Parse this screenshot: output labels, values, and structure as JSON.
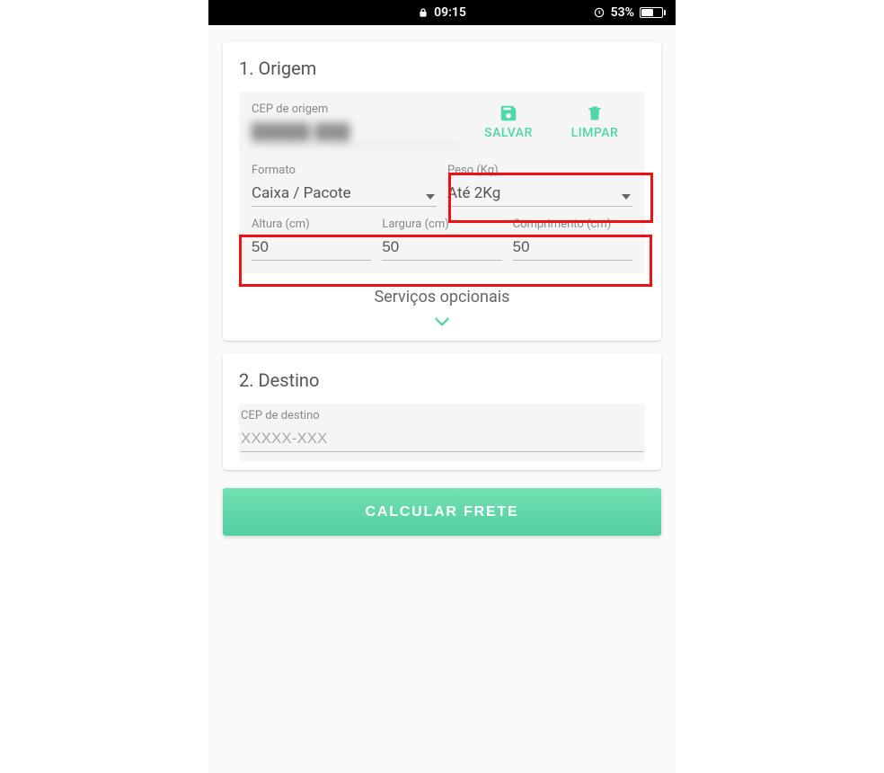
{
  "status": {
    "time": "09:15",
    "battery_pct": "53%",
    "battery_fill_pct": 53
  },
  "origem": {
    "title": "1. Origem",
    "cep_label": "CEP de origem",
    "cep_masked": "█████-███",
    "salvar_label": "SALVAR",
    "limpar_label": "LIMPAR",
    "formato_label": "Formato",
    "formato_value": "Caixa / Pacote",
    "peso_label": "Peso (Kg)",
    "peso_value": "Até 2Kg",
    "altura_label": "Altura (cm)",
    "altura_value": "50",
    "largura_label": "Largura (cm)",
    "largura_value": "50",
    "comprimento_label": "Comprimento (cm)",
    "comprimento_value": "50",
    "servicos_label": "Serviços opcionais"
  },
  "destino": {
    "title": "2. Destino",
    "cep_label": "CEP de destino",
    "cep_placeholder": "XXXXX-XXX"
  },
  "calc_label": "CALCULAR FRETE",
  "colors": {
    "accent": "#4fd6a9",
    "highlight": "#e11"
  }
}
